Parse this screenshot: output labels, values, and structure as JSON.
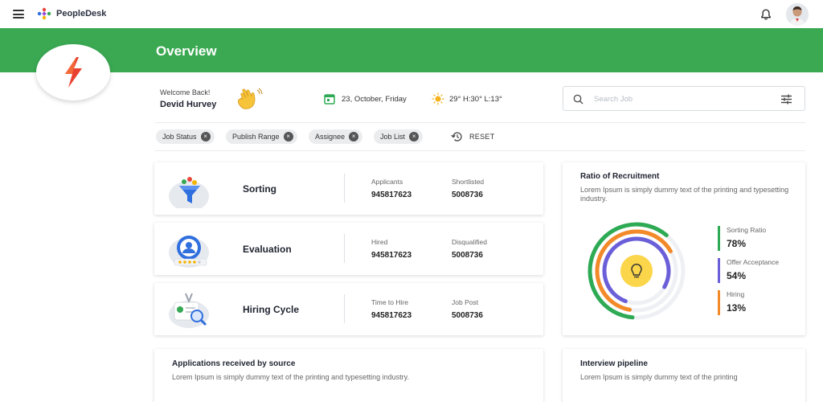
{
  "header": {
    "brand": "PeopleDesk",
    "menu_icon": "hamburger-icon",
    "notification_icon": "bell-icon",
    "avatar": "user-avatar"
  },
  "banner": {
    "title": "Overview",
    "logo_icon": "lightning-icon",
    "color": "#3aa952"
  },
  "welcome": {
    "greeting": "Welcome Back!",
    "name": "Devid Hurvey",
    "emoji_icon": "waving-hand-icon"
  },
  "date": "23, October, Friday",
  "weather": "29° H:30° L:13°",
  "search": {
    "placeholder": "Search Job",
    "value": ""
  },
  "filters": {
    "chips": [
      "Job Status",
      "Publish Range",
      "Assignee",
      "Job List"
    ],
    "reset_label": "RESET"
  },
  "stats": [
    {
      "title": "Sorting",
      "label1": "Applicants",
      "value1": "945817623",
      "label2": "Shortlisted",
      "value2": "5008736"
    },
    {
      "title": "Evaluation",
      "label1": "Hired",
      "value1": "945817623",
      "label2": "Disqualified",
      "value2": "5008736"
    },
    {
      "title": "Hiring Cycle",
      "label1": "Time to Hire",
      "value1": "945817623",
      "label2": "Job Post",
      "value2": "5008736"
    }
  ],
  "ratio": {
    "title": "Ratio of Recruitment",
    "description": "Lorem Ipsum is simply dummy text of the printing and typesetting industry.",
    "center_icon": "lightbulb-icon",
    "legend": [
      {
        "label": "Sorting Ratio",
        "value": "78%",
        "color": "#2eaa55"
      },
      {
        "label": "Offer Acceptance",
        "value": "54%",
        "color": "#6a5fd8"
      },
      {
        "label": "Hiring",
        "value": "13%",
        "color": "#f28a2a"
      }
    ]
  },
  "applications": {
    "title": "Applications received by source",
    "description": "Lorem Ipsum is simply dummy text of the printing and typesetting industry."
  },
  "pipeline": {
    "title": "Interview pipeline",
    "description": "Lorem Ipsum is simply dummy text of the printing"
  }
}
